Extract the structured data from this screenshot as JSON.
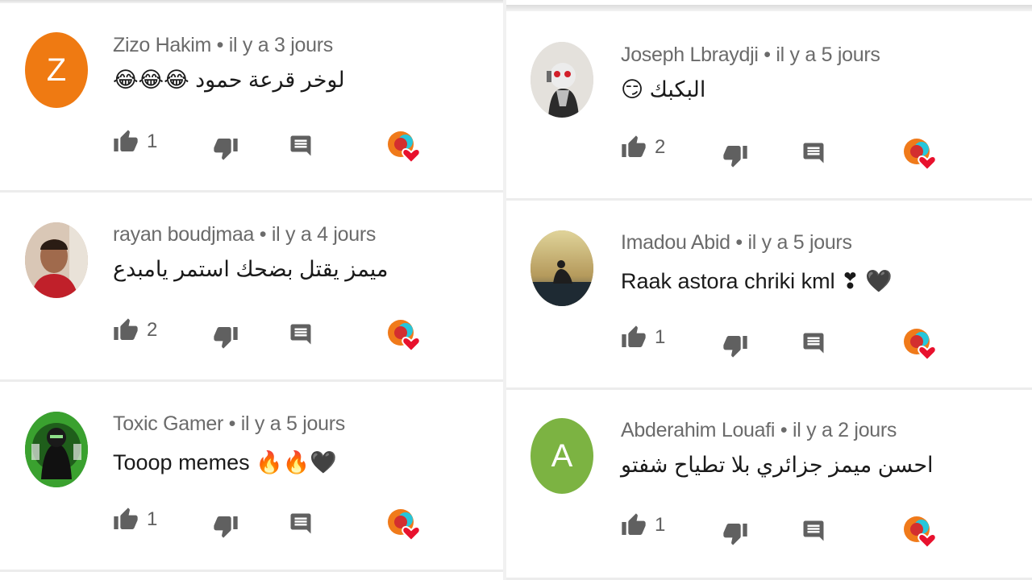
{
  "comments": [
    {
      "author": "Zizo Hakim",
      "time": "il y a 3 jours",
      "text": "لوخر قرعة حمود 😂😂😂",
      "likes": "1",
      "avatar_letter": "Z",
      "avatar_color": "#ef7a12"
    },
    {
      "author": "rayan boudjmaa",
      "time": "il y a 4 jours",
      "text": "ميمز يقتل بضحك استمر يامبدع",
      "likes": "2",
      "avatar_letter": "",
      "avatar_color": "#c9a48c"
    },
    {
      "author": "Toxic Gamer",
      "time": "il y a 5 jours",
      "text": "Tooop memes 🔥🔥🖤",
      "likes": "1",
      "avatar_letter": "",
      "avatar_color": "#2e8b2e"
    },
    {
      "author": "Joseph Lbraydji",
      "time": "il y a 5 jours",
      "text": "البكبك 😏",
      "likes": "2",
      "avatar_letter": "",
      "avatar_color": "#d8d8d8"
    },
    {
      "author": "Imadou Abid",
      "time": "il y a 5 jours",
      "text": "Raak astora chriki kml ❣ 🖤",
      "likes": "1",
      "avatar_letter": "",
      "avatar_color": "#b59a5c"
    },
    {
      "author": "Abderahim Louafi",
      "time": "il y a 2 jours",
      "text": "احسن ميمز جزائري بلا تطياح شفتو",
      "likes": "1",
      "avatar_letter": "A",
      "avatar_color": "#7cb342"
    }
  ],
  "separator": "•",
  "icons": {
    "like": "thumb-up-icon",
    "dislike": "thumb-down-icon",
    "reply": "reply-comment-icon",
    "creator_heart": "creator-heart-icon"
  },
  "colors": {
    "icon": "#606060",
    "author": "#6b6b6b",
    "heart": "#e8112d",
    "divider": "#ececec"
  }
}
